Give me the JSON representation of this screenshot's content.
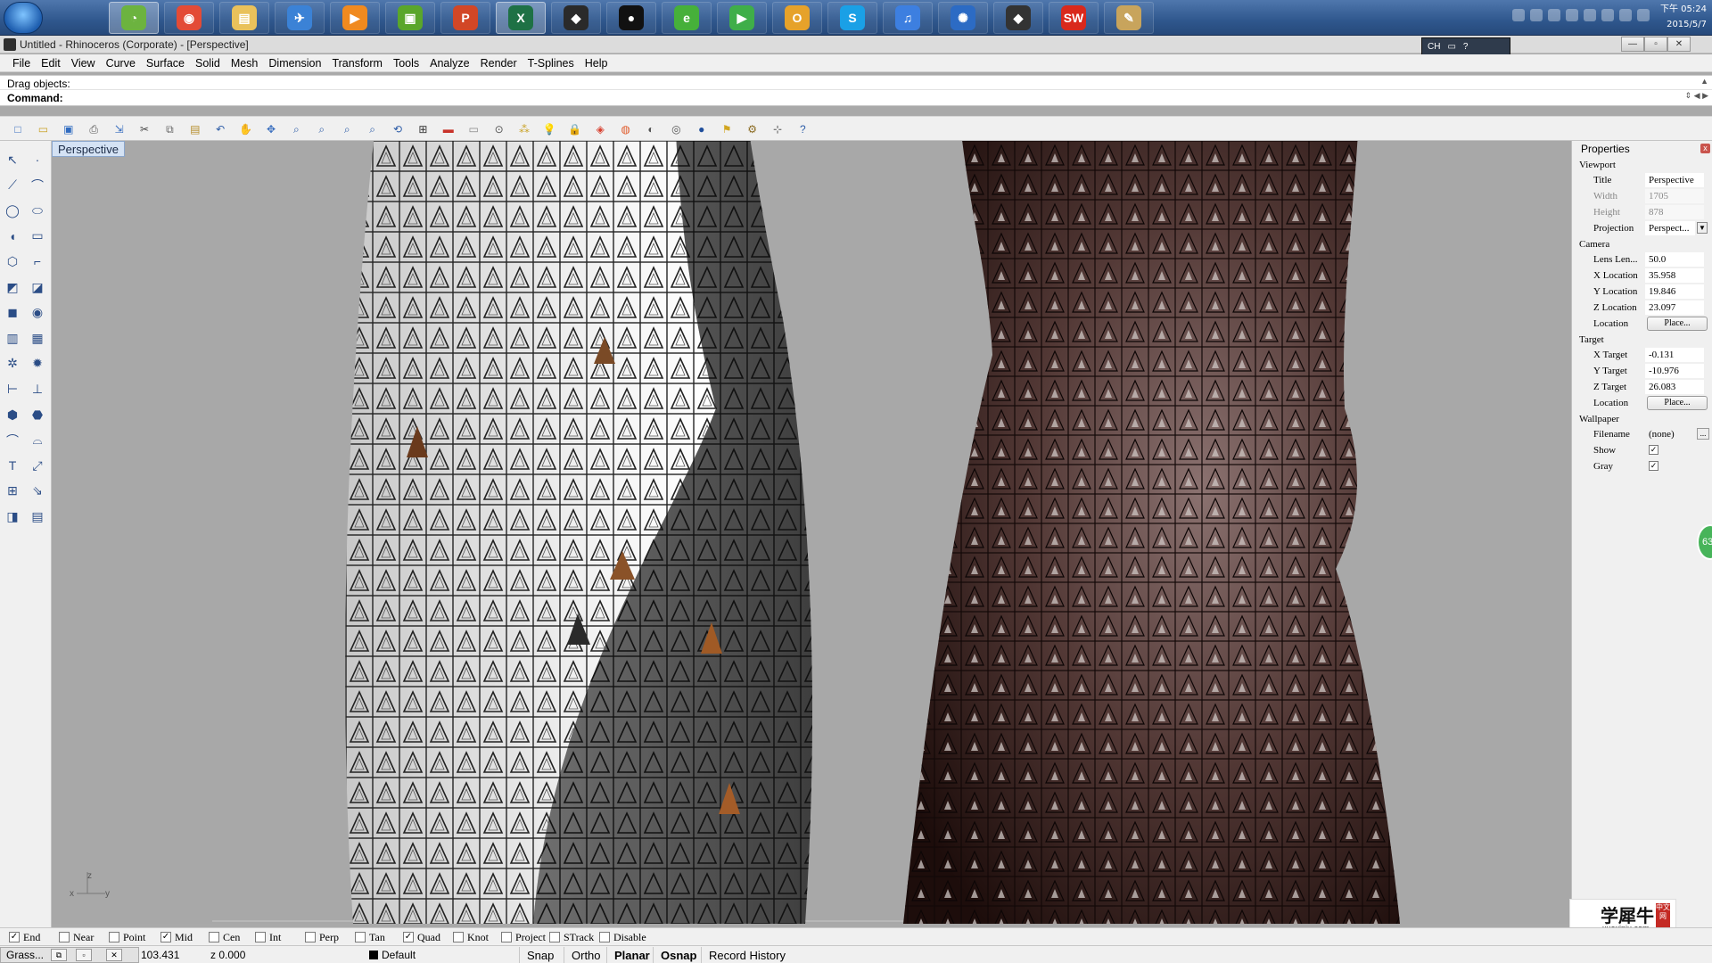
{
  "taskbar": {
    "icons": [
      {
        "name": "qq-manager-icon",
        "color": "#6cb33f",
        "glyph": "◔"
      },
      {
        "name": "chrome-icon",
        "color": "#e34b36",
        "glyph": "◉"
      },
      {
        "name": "file-explorer-icon",
        "color": "#e9c15b",
        "glyph": "▤"
      },
      {
        "name": "feather-icon",
        "color": "#3b82d6",
        "glyph": "✈"
      },
      {
        "name": "media-player-icon",
        "color": "#f08a1f",
        "glyph": "▶"
      },
      {
        "name": "video-icon",
        "color": "#5aa62b",
        "glyph": "▣"
      },
      {
        "name": "powerpoint-icon",
        "color": "#d24726",
        "glyph": "P"
      },
      {
        "name": "excel-icon",
        "color": "#1e7145",
        "glyph": "X"
      },
      {
        "name": "rhino-icon",
        "color": "#2a2a2a",
        "glyph": "◆"
      },
      {
        "name": "qq-icon",
        "color": "#111111",
        "glyph": "●"
      },
      {
        "name": "browser-360-icon",
        "color": "#46b03a",
        "glyph": "e"
      },
      {
        "name": "play-icon",
        "color": "#3fae49",
        "glyph": "▶"
      },
      {
        "name": "outlook-icon",
        "color": "#e6a22a",
        "glyph": "O"
      },
      {
        "name": "skype-icon",
        "color": "#1aa0e6",
        "glyph": "S"
      },
      {
        "name": "itunes-icon",
        "color": "#3d7fe0",
        "glyph": "♫"
      },
      {
        "name": "settings-wheel-icon",
        "color": "#2c6bc4",
        "glyph": "✺"
      },
      {
        "name": "rhino-app-icon",
        "color": "#333333",
        "glyph": "◆"
      },
      {
        "name": "solidworks-icon",
        "color": "#d9291c",
        "glyph": "SW"
      },
      {
        "name": "paint-icon",
        "color": "#c8a45c",
        "glyph": "✎"
      }
    ],
    "clock_line1": "下午 05:24",
    "clock_line2": "2015/5/7"
  },
  "window": {
    "title": "Untitled - Rhinoceros (Corporate) - [Perspective]",
    "lang": "CH"
  },
  "menu": [
    "File",
    "Edit",
    "View",
    "Curve",
    "Surface",
    "Solid",
    "Mesh",
    "Dimension",
    "Transform",
    "Tools",
    "Analyze",
    "Render",
    "T-Splines",
    "Help"
  ],
  "command": {
    "history": "Drag objects:",
    "prompt": "Command:"
  },
  "toolbar": {
    "buttons": [
      {
        "name": "new-icon",
        "glyph": "□"
      },
      {
        "name": "open-icon",
        "glyph": "▭"
      },
      {
        "name": "save-icon",
        "glyph": "▣"
      },
      {
        "name": "print-icon",
        "glyph": "⎙"
      },
      {
        "name": "import-icon",
        "glyph": "⇲"
      },
      {
        "name": "cut-icon",
        "glyph": "✂"
      },
      {
        "name": "copy-icon",
        "glyph": "⧉"
      },
      {
        "name": "paste-icon",
        "glyph": "▤"
      },
      {
        "name": "undo-icon",
        "glyph": "↶"
      },
      {
        "name": "pan-hand-icon",
        "glyph": "✋"
      },
      {
        "name": "rotate-view-icon",
        "glyph": "✥"
      },
      {
        "name": "zoom-icon",
        "glyph": "⌕"
      },
      {
        "name": "zoom-window-icon",
        "glyph": "⌕"
      },
      {
        "name": "zoom-extents-icon",
        "glyph": "⌕"
      },
      {
        "name": "zoom-selected-icon",
        "glyph": "⌕"
      },
      {
        "name": "undo-view-icon",
        "glyph": "⟲"
      },
      {
        "name": "four-viewports-icon",
        "glyph": "⊞"
      },
      {
        "name": "car-icon",
        "glyph": "▬"
      },
      {
        "name": "wire-car-icon",
        "glyph": "▭"
      },
      {
        "name": "camera-target-icon",
        "glyph": "⊙"
      },
      {
        "name": "select-points-icon",
        "glyph": "⁂"
      },
      {
        "name": "light-bulb-icon",
        "glyph": "💡"
      },
      {
        "name": "lock-icon",
        "glyph": "🔒"
      },
      {
        "name": "material-icon",
        "glyph": "◈"
      },
      {
        "name": "color-wheel-icon",
        "glyph": "◍"
      },
      {
        "name": "shade-sphere-icon",
        "glyph": "◐"
      },
      {
        "name": "render-sphere-icon",
        "glyph": "◎"
      },
      {
        "name": "environment-icon",
        "glyph": "●"
      },
      {
        "name": "flag-icon",
        "glyph": "⚑"
      },
      {
        "name": "options-gear-icon",
        "glyph": "⚙"
      },
      {
        "name": "grid-snap-icon",
        "glyph": "⊹"
      },
      {
        "name": "help-icon",
        "glyph": "?"
      }
    ]
  },
  "sidebar": {
    "buttons": [
      {
        "name": "select-arrow-icon",
        "glyph": "↖"
      },
      {
        "name": "point-icon",
        "glyph": "·"
      },
      {
        "name": "polyline-icon",
        "glyph": "⟋"
      },
      {
        "name": "curve-points-icon",
        "glyph": "⌒"
      },
      {
        "name": "circle-icon",
        "glyph": "◯"
      },
      {
        "name": "ellipse-icon",
        "glyph": "⬭"
      },
      {
        "name": "arc-icon",
        "glyph": "◖"
      },
      {
        "name": "rectangle-icon",
        "glyph": "▭"
      },
      {
        "name": "polygon-icon",
        "glyph": "⬡"
      },
      {
        "name": "fillet-icon",
        "glyph": "⌐"
      },
      {
        "name": "surface-icon",
        "glyph": "◩"
      },
      {
        "name": "loft-icon",
        "glyph": "◪"
      },
      {
        "name": "box-icon",
        "glyph": "◼"
      },
      {
        "name": "boolean-icon",
        "glyph": "◉"
      },
      {
        "name": "extrude-icon",
        "glyph": "▥"
      },
      {
        "name": "mesh-icon",
        "glyph": "▦"
      },
      {
        "name": "transform-icon",
        "glyph": "✲"
      },
      {
        "name": "explode-icon",
        "glyph": "✹"
      },
      {
        "name": "dimension-icon",
        "glyph": "⊢"
      },
      {
        "name": "drafting-icon",
        "glyph": "⊥"
      },
      {
        "name": "group-icon",
        "glyph": "⬢"
      },
      {
        "name": "block-icon",
        "glyph": "⬣"
      },
      {
        "name": "join-icon",
        "glyph": "⌒"
      },
      {
        "name": "split-icon",
        "glyph": "⌓"
      },
      {
        "name": "text-icon",
        "glyph": "T"
      },
      {
        "name": "scale-icon",
        "glyph": "⤢"
      },
      {
        "name": "array-icon",
        "glyph": "⊞"
      },
      {
        "name": "project-icon",
        "glyph": "⇘"
      },
      {
        "name": "cube-view-icon",
        "glyph": "◨"
      },
      {
        "name": "ruler-icon",
        "glyph": "▤"
      }
    ]
  },
  "viewport": {
    "tab": "Perspective",
    "axis_x": "x",
    "axis_y": "y",
    "axis_z": "z"
  },
  "properties": {
    "header": "Properties",
    "close": "x",
    "viewport_section": "Viewport",
    "rows1": [
      {
        "label": "Title",
        "value": "Perspective",
        "dim": false
      },
      {
        "label": "Width",
        "value": "1705",
        "dim": true
      },
      {
        "label": "Height",
        "value": "878",
        "dim": true
      }
    ],
    "projection_label": "Projection",
    "projection_value": "Perspect...",
    "camera_section": "Camera",
    "camera_rows": [
      {
        "label": "Lens Len...",
        "value": "50.0"
      },
      {
        "label": "X Location",
        "value": "35.958"
      },
      {
        "label": "Y Location",
        "value": "19.846"
      },
      {
        "label": "Z Location",
        "value": "23.097"
      }
    ],
    "location_label": "Location",
    "place_button": "Place...",
    "target_section": "Target",
    "target_rows": [
      {
        "label": "X Target",
        "value": "-0.131"
      },
      {
        "label": "Y Target",
        "value": "-10.976"
      },
      {
        "label": "Z Target",
        "value": "26.083"
      }
    ],
    "wallpaper_section": "Wallpaper",
    "filename_label": "Filename",
    "filename_value": "(none)",
    "browse_button": "...",
    "show_label": "Show",
    "gray_label": "Gray"
  },
  "watermark": {
    "title": "学犀牛",
    "sub": "xuexiniu.com",
    "seal": "中文网"
  },
  "badge": "63",
  "osnaps": [
    {
      "label": "End",
      "checked": true
    },
    {
      "label": "Near",
      "checked": false
    },
    {
      "label": "Point",
      "checked": false
    },
    {
      "label": "Mid",
      "checked": true
    },
    {
      "label": "Cen",
      "checked": false
    },
    {
      "label": "Int",
      "checked": false
    },
    {
      "label": "Perp",
      "checked": false
    },
    {
      "label": "Tan",
      "checked": false
    },
    {
      "label": "Quad",
      "checked": true
    },
    {
      "label": "Knot",
      "checked": false
    },
    {
      "label": "Project",
      "checked": false
    },
    {
      "label": "STrack",
      "checked": false
    },
    {
      "label": "Disable",
      "checked": false
    }
  ],
  "status": {
    "grass": "Grass...",
    "coord_y": "103.431",
    "coord_z": "z 0.000",
    "layer": "Default",
    "panes": [
      "Snap",
      "Ortho",
      "Planar",
      "Osnap",
      "Record History"
    ]
  },
  "colors": {
    "tower_light": "#d8d8d8",
    "tower_dark": "#2a1614",
    "accent": "#d4e2f4"
  }
}
